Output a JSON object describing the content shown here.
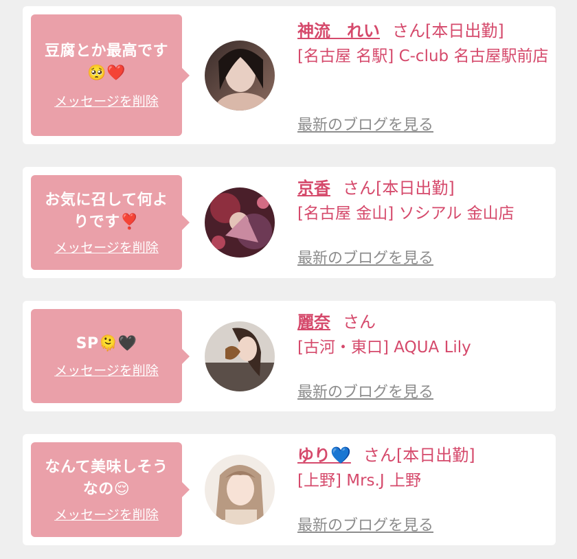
{
  "common": {
    "delete_label": "メッセージを削除",
    "blog_label": "最新のブログを見る",
    "san": "さん"
  },
  "cards": [
    {
      "message_line1": "豆腐とか最高です",
      "message_line2": "🥺❤️",
      "name": "神流　れい",
      "status": "[本日出勤]",
      "shop": "[名古屋 名駅] C-club 名古屋駅前店"
    },
    {
      "message_line1": "お気に召して何よ",
      "message_line2": "りです❣️",
      "name": "京香",
      "status": "[本日出勤]",
      "shop": "[名古屋 金山] ソシアル 金山店"
    },
    {
      "message_line1": "SP🫠🖤",
      "message_line2": "",
      "name": "麗奈",
      "status": "",
      "shop": "[古河・東口] AQUA Lily"
    },
    {
      "message_line1": "なんて美味しそう",
      "message_line2": "なの😌",
      "name": "ゆり💙",
      "status": "[本日出勤]",
      "shop": "[上野] Mrs.J 上野"
    }
  ],
  "colors": {
    "accent": "#d5496b",
    "bubble": "#eaa0a9",
    "link_gray": "#8c8c8c"
  }
}
